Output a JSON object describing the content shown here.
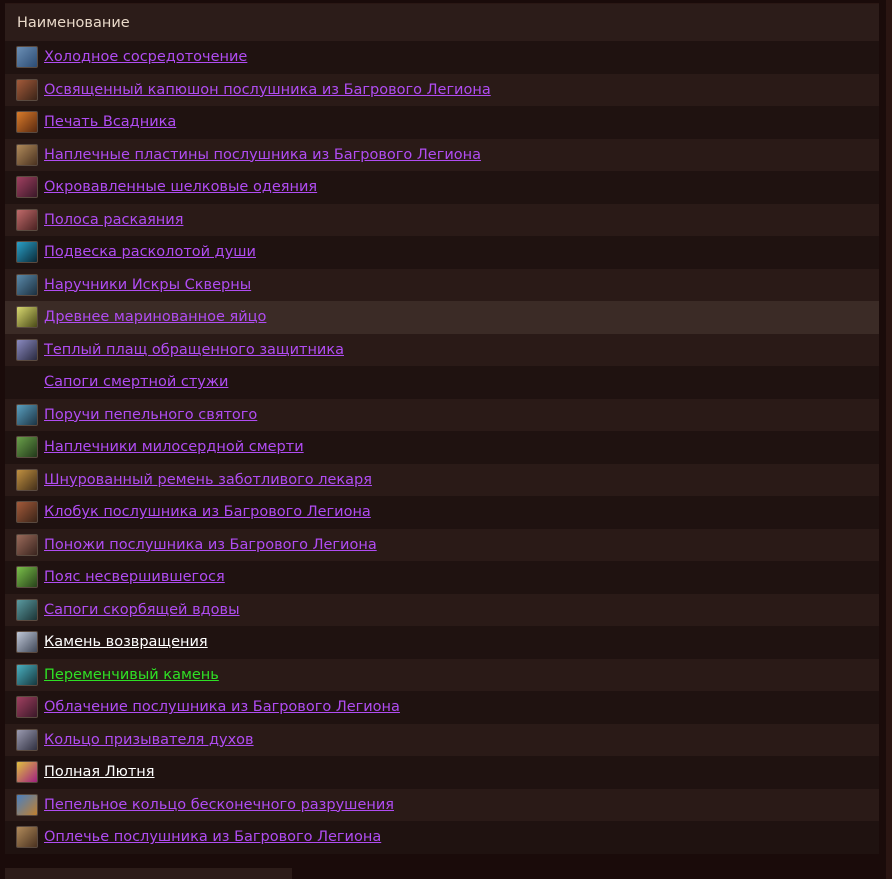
{
  "table": {
    "header": "Наименование",
    "rows": [
      {
        "name": "Холодное сосредоточение",
        "quality": "epic",
        "icon": "frost-focus-icon",
        "icon_colors": [
          "#6b8fb5",
          "#2c4b73"
        ]
      },
      {
        "name": "Освященный капюшон послушника из Багрового Легиона",
        "quality": "epic",
        "icon": "hood-icon",
        "icon_colors": [
          "#a35a3a",
          "#3b2418"
        ]
      },
      {
        "name": "Печать Всадника",
        "quality": "epic",
        "icon": "seal-icon",
        "icon_colors": [
          "#d97b2a",
          "#5a2a10"
        ]
      },
      {
        "name": "Наплечные пластины послушника из Багрового Легиона",
        "quality": "epic",
        "icon": "shoulder-plates-icon",
        "icon_colors": [
          "#b08a5a",
          "#4a3220"
        ]
      },
      {
        "name": "Окровавленные шелковые одеяния",
        "quality": "epic",
        "icon": "robe-icon",
        "icon_colors": [
          "#a04060",
          "#3a1828"
        ]
      },
      {
        "name": "Полоса раскаяния",
        "quality": "epic",
        "icon": "belt-icon",
        "icon_colors": [
          "#c06a6a",
          "#4a2222"
        ]
      },
      {
        "name": "Подвеска расколотой души",
        "quality": "epic",
        "icon": "pendant-icon",
        "icon_colors": [
          "#2aa0c8",
          "#0a2a38"
        ]
      },
      {
        "name": "Наручники Искры Скверны",
        "quality": "epic",
        "icon": "bracers-icon",
        "icon_colors": [
          "#5a8aaa",
          "#1c3040"
        ]
      },
      {
        "name": "Древнее маринованное яйцо",
        "quality": "epic",
        "icon": "egg-icon",
        "icon_colors": [
          "#d8d870",
          "#4a4a18"
        ]
      },
      {
        "name": "Теплый плащ обращенного защитника",
        "quality": "epic",
        "icon": "cloak-icon",
        "icon_colors": [
          "#8a8ac0",
          "#2a2a40"
        ]
      },
      {
        "name": "Сапоги смертной стужи",
        "quality": "epic",
        "icon": "",
        "icon_colors": []
      },
      {
        "name": "Поручи пепельного святого",
        "quality": "epic",
        "icon": "wrist-guards-icon",
        "icon_colors": [
          "#5aa0c0",
          "#1c3444"
        ]
      },
      {
        "name": "Наплечники милосердной смерти",
        "quality": "epic",
        "icon": "shoulders-icon",
        "icon_colors": [
          "#6aa04a",
          "#22381a"
        ]
      },
      {
        "name": "Шнурованный ремень заботливого лекаря",
        "quality": "epic",
        "icon": "laced-belt-icon",
        "icon_colors": [
          "#c09040",
          "#44301a"
        ]
      },
      {
        "name": "Клобук послушника из Багрового Легиона",
        "quality": "epic",
        "icon": "cowl-icon",
        "icon_colors": [
          "#a35a3a",
          "#3b2418"
        ]
      },
      {
        "name": "Поножи послушника из Багрового Легиона",
        "quality": "epic",
        "icon": "leggings-icon",
        "icon_colors": [
          "#9a6a5a",
          "#3a241e"
        ]
      },
      {
        "name": "Пояс несвершившегося",
        "quality": "epic",
        "icon": "sash-icon",
        "icon_colors": [
          "#7ac04a",
          "#28421a"
        ]
      },
      {
        "name": "Сапоги скорбящей вдовы",
        "quality": "epic",
        "icon": "boots-icon",
        "icon_colors": [
          "#5a9aa0",
          "#1c3436"
        ]
      },
      {
        "name": "Камень возвращения",
        "quality": "common",
        "icon": "hearthstone-icon",
        "icon_colors": [
          "#c0c8d8",
          "#404858"
        ]
      },
      {
        "name": "Переменчивый камень",
        "quality": "uncommon",
        "icon": "shifting-stone-icon",
        "icon_colors": [
          "#4ab0c0",
          "#16383e"
        ]
      },
      {
        "name": "Облачение послушника из Багрового Легиона",
        "quality": "epic",
        "icon": "vestment-icon",
        "icon_colors": [
          "#a04060",
          "#3a1828"
        ]
      },
      {
        "name": "Кольцо призывателя духов",
        "quality": "epic",
        "icon": "spirit-ring-icon",
        "icon_colors": [
          "#9a9ab0",
          "#303040"
        ]
      },
      {
        "name": "Полная Лютня",
        "quality": "common",
        "icon": "lute-icon",
        "icon_colors": [
          "#e0c040",
          "#a02080"
        ]
      },
      {
        "name": "Пепельное кольцо бесконечного разрушения",
        "quality": "epic",
        "icon": "ash-ring-icon",
        "icon_colors": [
          "#4a80c0",
          "#c08030"
        ]
      },
      {
        "name": "Оплечье послушника из Багрового Легиона",
        "quality": "epic",
        "icon": "mantle-icon",
        "icon_colors": [
          "#b08a5a",
          "#4a3220"
        ]
      }
    ]
  },
  "hovered_row": 8
}
